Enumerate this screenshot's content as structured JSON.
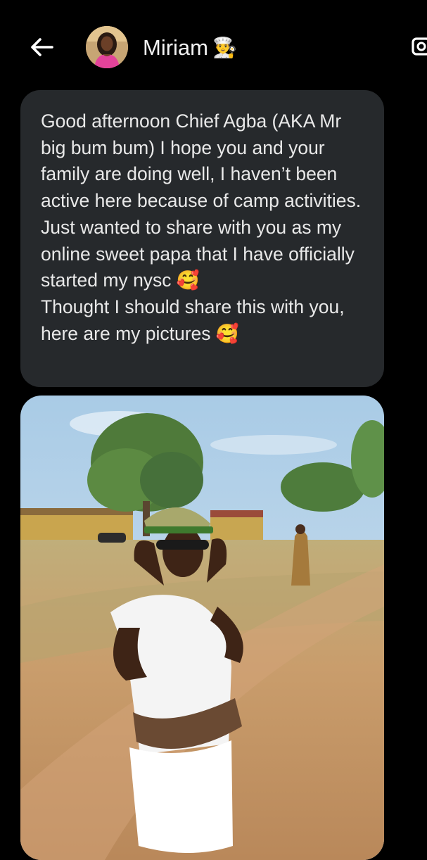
{
  "header": {
    "back_icon": "arrow-left-icon",
    "contact_name": "Miriam",
    "name_emoji": "👨‍🍳",
    "avatar_icon": "contact-avatar",
    "call_icon": "video-camera-icon"
  },
  "message": {
    "text": "Good afternoon Chief Agba (AKA Mr big bum bum) I hope you and your family are doing well, I haven’t been active here because of camp activities.\nJust wanted to share with you as my online sweet papa that I have officially started my nysc 🥰\nThought I should share this with you, here are my pictures 🥰"
  },
  "attachment": {
    "type": "photo"
  },
  "colors": {
    "background": "#000000",
    "bubble": "#26292c",
    "text": "#e9e9e9"
  }
}
